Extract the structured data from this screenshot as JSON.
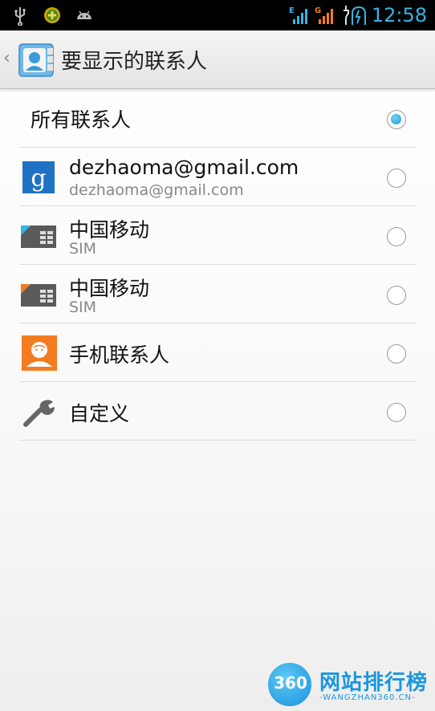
{
  "status_bar": {
    "time": "12:58",
    "network_1": "E",
    "network_2": "G"
  },
  "action_bar": {
    "back": "‹",
    "title": "要显示的联系人"
  },
  "list": {
    "all_contacts": {
      "label": "所有联系人",
      "selected": true
    },
    "items": [
      {
        "label": "dezhaoma@gmail.com",
        "sub": "dezhaoma@gmail.com",
        "icon": "google-icon",
        "selected": false
      },
      {
        "label": "中国移动",
        "sub": "SIM",
        "icon": "sim-card-blue-icon",
        "selected": false
      },
      {
        "label": "中国移动",
        "sub": "SIM",
        "icon": "sim-card-orange-icon",
        "selected": false
      },
      {
        "label": "手机联系人",
        "icon": "phone-contacts-icon",
        "selected": false
      },
      {
        "label": "自定义",
        "icon": "wrench-icon",
        "selected": false
      }
    ]
  },
  "watermark": {
    "number": "360",
    "name": "网站排行榜",
    "sub": "-WANGZHAN360.CN-"
  },
  "colors": {
    "accent": "#33b5e5",
    "radio_fill": "#1a9bd6",
    "orange": "#f47c20"
  }
}
